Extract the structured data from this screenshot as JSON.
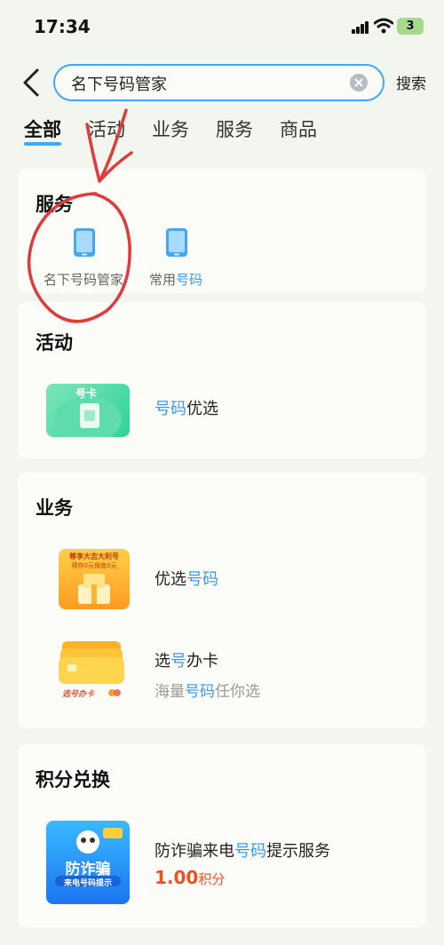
{
  "status_bar": {
    "time": "17:34",
    "battery": "3"
  },
  "search": {
    "value": "名下号码管家",
    "submit_label": "搜索"
  },
  "tabs": [
    {
      "label": "全部",
      "active": true
    },
    {
      "label": "活动",
      "active": false
    },
    {
      "label": "业务",
      "active": false
    },
    {
      "label": "服务",
      "active": false
    },
    {
      "label": "商品",
      "active": false
    }
  ],
  "service_section": {
    "title": "服务",
    "items": [
      {
        "label": "名下号码管家",
        "icon": "phone-icon"
      },
      {
        "label_pre": "常用",
        "label_hl": "号码",
        "icon": "phone-icon"
      }
    ]
  },
  "activity_section": {
    "title": "活动",
    "items": [
      {
        "thumb_text": "号卡",
        "title_hl": "号码",
        "title_rest": "优选"
      }
    ]
  },
  "business_section": {
    "title": "业务",
    "items": [
      {
        "thumb_text": "尊享大吉大利号",
        "thumb_sub": "预存0元保底0元",
        "title_pre": "优选",
        "title_hl": "号码"
      },
      {
        "thumb_text": "选号办卡",
        "title_pre": "选",
        "title_hl": "号",
        "title_post": "办卡",
        "sub_pre": "海量",
        "sub_hl": "号码",
        "sub_post": "任你选"
      }
    ]
  },
  "points_section": {
    "title": "积分兑换",
    "items": [
      {
        "thumb_text": "防诈骗",
        "thumb_sub": "来电号码提示",
        "title_pre": "防诈骗来电",
        "title_hl": "号码",
        "title_post": "提示服务",
        "price": "1.00",
        "price_unit": "积分"
      }
    ]
  },
  "colors": {
    "accent": "#3ea7ff",
    "highlight": "#3a9be8",
    "price": "#f0501e",
    "annotation": "#e03a3a"
  }
}
